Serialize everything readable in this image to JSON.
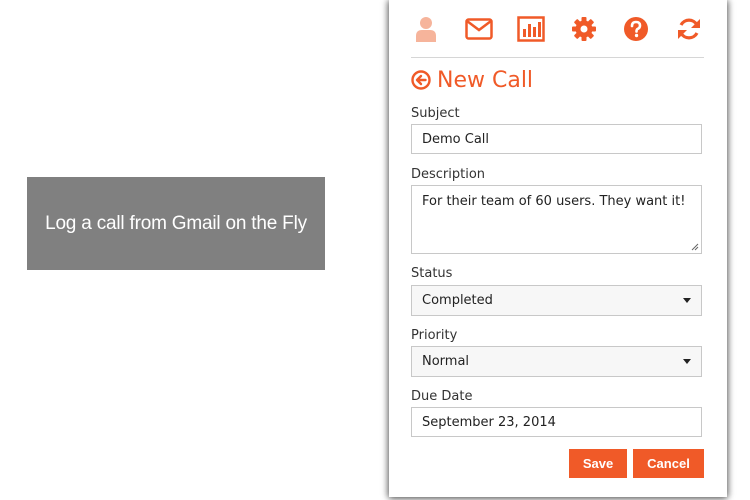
{
  "caption": {
    "text": "Log a call from Gmail on the Fly"
  },
  "colors": {
    "accent": "#f05a28",
    "accent_light": "#f6b49b",
    "caption_bg": "#808080"
  },
  "toolbar": {
    "icons": [
      "user-icon",
      "mail-icon",
      "bar-chart-icon",
      "gear-icon",
      "help-icon",
      "refresh-icon"
    ]
  },
  "form": {
    "title": "New Call",
    "subject_label": "Subject",
    "subject_value": "Demo Call",
    "description_label": "Description",
    "description_value": "For their team of 60 users. They want it!",
    "status_label": "Status",
    "status_value": "Completed",
    "priority_label": "Priority",
    "priority_value": "Normal",
    "due_date_label": "Due Date",
    "due_date_value": "September 23, 2014",
    "save_label": "Save",
    "cancel_label": "Cancel"
  }
}
